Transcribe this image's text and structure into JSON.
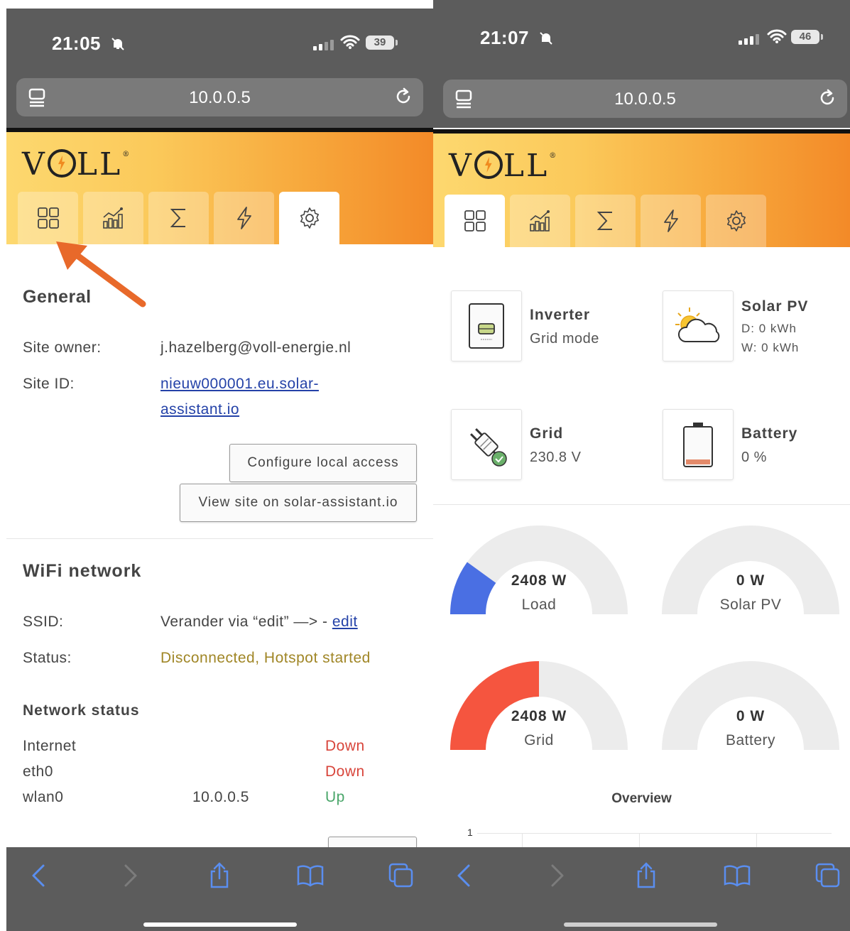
{
  "left": {
    "status_time": "21:05",
    "battery": "39",
    "url": "10.0.0.5",
    "general": {
      "title": "General",
      "site_owner_label": "Site owner:",
      "site_owner_value": "j.hazelberg@voll-energie.nl",
      "site_id_label": "Site ID:",
      "site_id_line1": "nieuw000001.eu.solar-",
      "site_id_line2": "assistant.io",
      "configure_button": "Configure local access",
      "view_button": "View site on solar-assistant.io"
    },
    "wifi": {
      "title": "WiFi network",
      "ssid_label": "SSID:",
      "ssid_value": "Verander via “edit” —> - ",
      "ssid_edit": "edit",
      "status_label": "Status:",
      "status_value": "Disconnected, Hotspot started"
    },
    "network": {
      "title": "Network status",
      "rows": [
        {
          "name": "Internet",
          "ip": "",
          "state": "Down"
        },
        {
          "name": "eth0",
          "ip": "",
          "state": "Down"
        },
        {
          "name": "wlan0",
          "ip": "10.0.0.5",
          "state": "Up"
        }
      ]
    }
  },
  "right": {
    "status_time": "21:07",
    "battery": "46",
    "url": "10.0.0.5",
    "cards": {
      "inverter_title": "Inverter",
      "inverter_sub": "Grid mode",
      "solar_title": "Solar PV",
      "solar_d": "D: 0 kWh",
      "solar_w": "W: 0 kWh",
      "grid_title": "Grid",
      "grid_sub": "230.8 V",
      "battery_title": "Battery",
      "battery_sub": "0 %"
    },
    "gauges": [
      {
        "value": "2408 W",
        "label": "Load",
        "fill": 0.2,
        "color": "#4a6fe3"
      },
      {
        "value": "0 W",
        "label": "Solar PV",
        "fill": 0,
        "color": "#4a6fe3"
      },
      {
        "value": "2408 W",
        "label": "Grid",
        "fill": 0.5,
        "color": "#f5553f"
      },
      {
        "value": "0 W",
        "label": "Battery",
        "fill": 0,
        "color": "#4a6fe3"
      }
    ],
    "overview_title": "Overview",
    "overview_y_tick": "1"
  },
  "logo": "VOLL",
  "icons": [
    "dashboard-icon",
    "chart-icon",
    "sigma-icon",
    "lightning-icon",
    "gear-icon",
    "back-icon",
    "forward-icon",
    "share-icon",
    "bookmarks-icon",
    "tabs-icon"
  ],
  "colors": {
    "accent": "#f38a28",
    "link": "#2442a8",
    "warn": "#a08626",
    "down": "#d8453b",
    "up": "#4aa66a"
  }
}
